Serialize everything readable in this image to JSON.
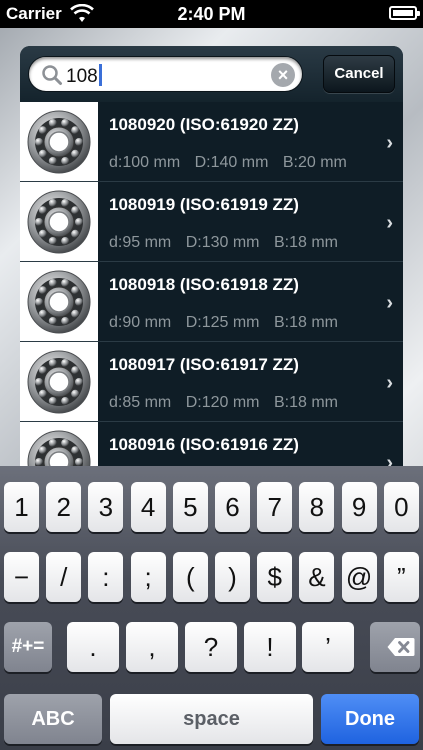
{
  "status_bar": {
    "carrier": "Carrier",
    "time": "2:40 PM",
    "battery_level": 1.0
  },
  "search": {
    "value": "108",
    "cancel_label": "Cancel",
    "clear_symbol": "×"
  },
  "results": [
    {
      "title": "1080920  (ISO:61920 ZZ)",
      "d": "d:100 mm",
      "D": "D:140 mm",
      "B": "B:20 mm"
    },
    {
      "title": "1080919  (ISO:61919 ZZ)",
      "d": "d:95 mm",
      "D": "D:130 mm",
      "B": "B:18 mm"
    },
    {
      "title": "1080918  (ISO:61918 ZZ)",
      "d": "d:90 mm",
      "D": "D:125 mm",
      "B": "B:18 mm"
    },
    {
      "title": "1080917  (ISO:61917 ZZ)",
      "d": "d:85 mm",
      "D": "D:120 mm",
      "B": "B:18 mm"
    },
    {
      "title": "1080916  (ISO:61916 ZZ)",
      "d": "",
      "D": "",
      "B": ""
    }
  ],
  "keyboard": {
    "row1": [
      "1",
      "2",
      "3",
      "4",
      "5",
      "6",
      "7",
      "8",
      "9",
      "0"
    ],
    "row2": [
      "−",
      "/",
      ":",
      ";",
      "(",
      ")",
      "$",
      "&",
      "@",
      "”"
    ],
    "row3": {
      "shift_label": "#+=",
      "keys": [
        ".",
        ",",
        "?",
        "!",
        "’"
      ],
      "backspace_icon": "backspace-icon"
    },
    "row4": {
      "abc": "ABC",
      "space": "space",
      "done": "Done"
    }
  },
  "colors": {
    "panel": "#101f28",
    "done_key": "#2a6fe8",
    "dims_text": "#8e979c"
  }
}
